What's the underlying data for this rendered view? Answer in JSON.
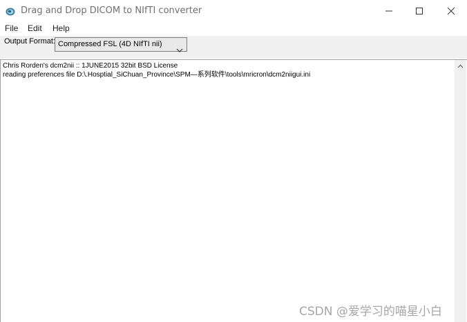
{
  "window": {
    "title": "Drag and Drop DICOM to NIfTI converter",
    "icon": "brain-icon"
  },
  "menu": {
    "items": [
      "File",
      "Edit",
      "Help"
    ]
  },
  "toolbar": {
    "output_format_label": "Output Format:",
    "output_format_value": "Compressed FSL (4D NIfTI nii)"
  },
  "log": {
    "lines": [
      "Chris Rorden's dcm2nii :: 1JUNE2015 32bit BSD License",
      "reading preferences file D:\\.Hosptial_SiChuan_Province\\SPM—系列软件\\tools\\mricron\\dcm2niigui.ini"
    ]
  },
  "watermark": {
    "text": "CSDN @爱学习的喵星小白"
  }
}
